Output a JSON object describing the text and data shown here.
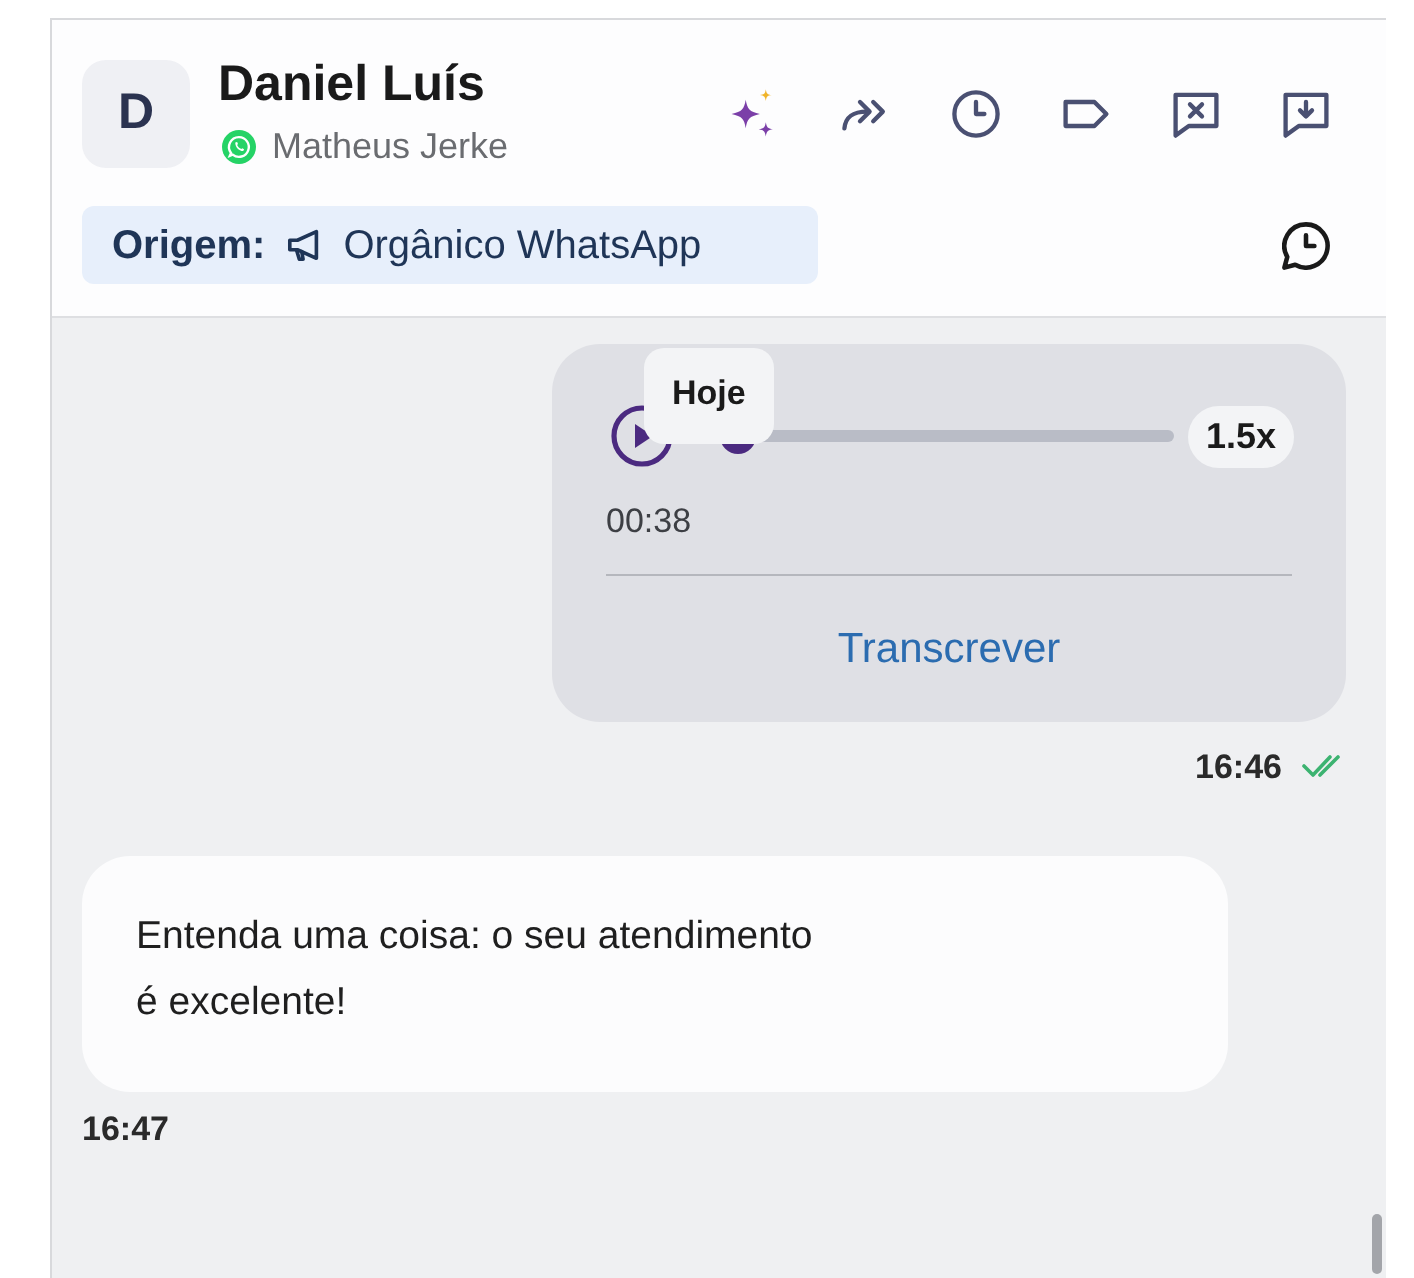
{
  "contact": {
    "avatar_letter": "D",
    "name": "Daniel Luís",
    "agent": "Matheus Jerke"
  },
  "origin": {
    "label": "Origem:",
    "value": "Orgânico WhatsApp"
  },
  "messages": [
    {
      "kind": "audio",
      "outgoing": true,
      "duration": "00:38",
      "speed": "1.5x",
      "level": 0.05,
      "action": "Transcrever",
      "time": "16:46",
      "read": true
    },
    {
      "kind": "text",
      "outgoing": false,
      "text": "Entenda uma coisa: o seu atendimento\né excelente!",
      "time": "16:47"
    }
  ],
  "date_tooltip": "Hoje"
}
